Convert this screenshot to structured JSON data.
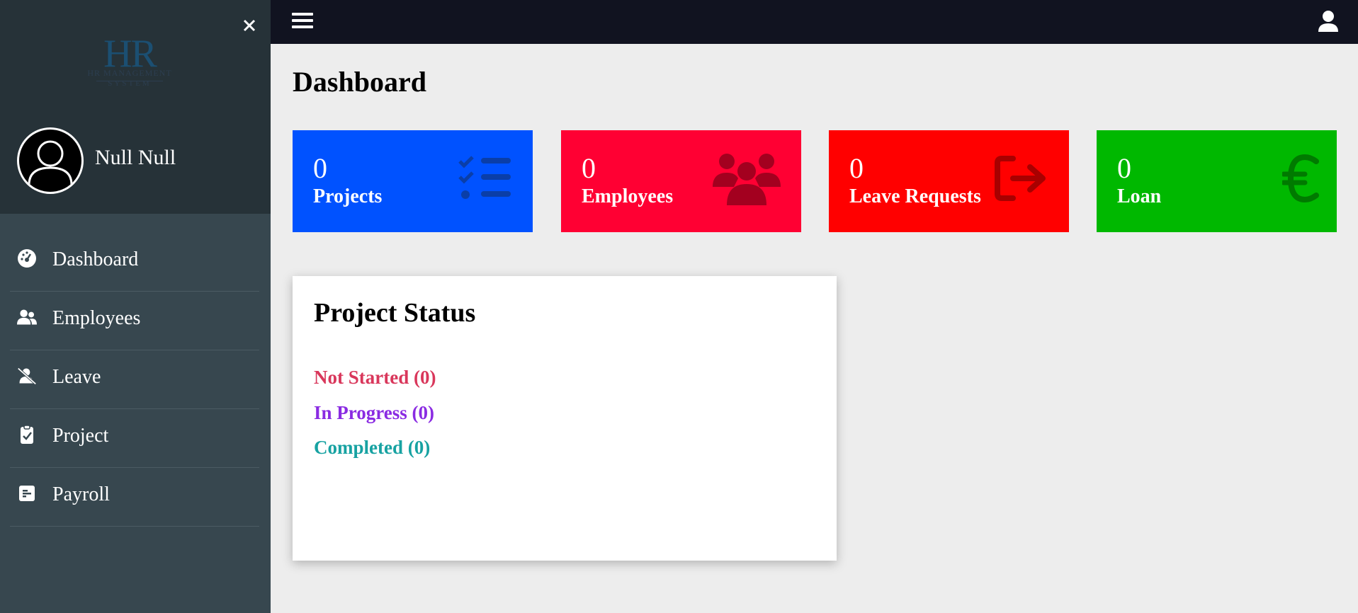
{
  "sidebar": {
    "logo": {
      "text": "HR",
      "subtitle": "HR MANAGEMENT",
      "system": "SYSTEM"
    },
    "user_name": "Null Null",
    "items": [
      {
        "label": "Dashboard",
        "icon": "gauge-icon"
      },
      {
        "label": "Employees",
        "icon": "users-icon"
      },
      {
        "label": "Leave",
        "icon": "user-slash-icon"
      },
      {
        "label": "Project",
        "icon": "clipboard-check-icon"
      },
      {
        "label": "Payroll",
        "icon": "receipt-icon"
      }
    ]
  },
  "page": {
    "title": "Dashboard"
  },
  "cards": [
    {
      "value": "0",
      "label": "Projects",
      "color": "#0052ff",
      "icon": "list-check-icon"
    },
    {
      "value": "0",
      "label": "Employees",
      "color": "#ff0033",
      "icon": "people-group-icon"
    },
    {
      "value": "0",
      "label": "Leave Requests",
      "color": "#ff0000",
      "icon": "sign-out-icon"
    },
    {
      "value": "0",
      "label": "Loan",
      "color": "#00b800",
      "icon": "euro-icon"
    }
  ],
  "project_status": {
    "title": "Project Status",
    "not_started": "Not Started (0)",
    "in_progress": "In Progress (0)",
    "completed": "Completed (0)",
    "colors": {
      "not_started": "#d9375b",
      "in_progress": "#8a2be2",
      "completed": "#17a2a2"
    }
  }
}
